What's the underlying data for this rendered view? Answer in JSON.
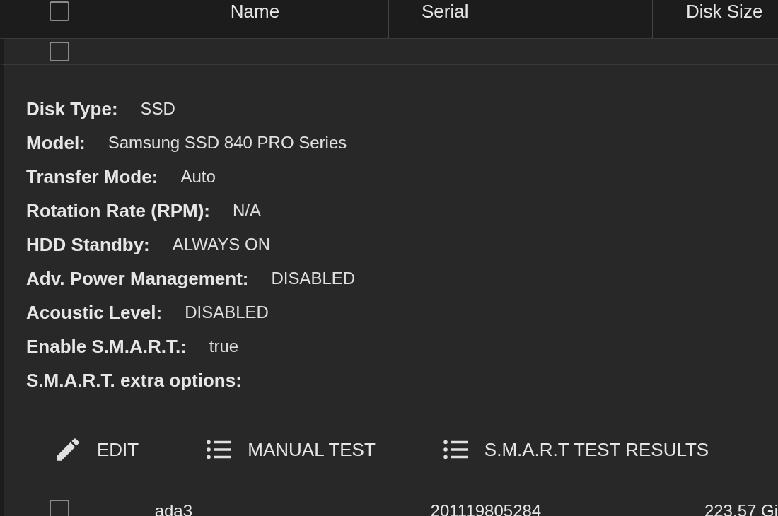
{
  "table": {
    "columns": [
      {
        "label": "Name"
      },
      {
        "label": "Serial"
      },
      {
        "label": "Disk Size"
      }
    ],
    "header_checkbox": {
      "checked": false
    },
    "expanded_row": {
      "checkbox": {
        "checked": false
      },
      "details": [
        {
          "label": "Disk Type:",
          "value": "SSD"
        },
        {
          "label": "Model:",
          "value": "Samsung SSD 840 PRO Series"
        },
        {
          "label": "Transfer Mode:",
          "value": "Auto"
        },
        {
          "label": "Rotation Rate (RPM):",
          "value": "N/A"
        },
        {
          "label": "HDD Standby:",
          "value": "ALWAYS ON"
        },
        {
          "label": "Adv. Power Management:",
          "value": "DISABLED"
        },
        {
          "label": "Acoustic Level:",
          "value": "DISABLED"
        },
        {
          "label": "Enable S.M.A.R.T.:",
          "value": "true"
        },
        {
          "label": "S.M.A.R.T. extra options:"
        }
      ],
      "actions": [
        {
          "kind": "edit",
          "label": "EDIT"
        },
        {
          "kind": "list",
          "label": "MANUAL TEST"
        },
        {
          "kind": "list",
          "label": "S.M.A.R.T TEST RESULTS"
        }
      ]
    },
    "rows": [
      {
        "checked": false,
        "cells": [
          "ada3",
          "201119805284",
          "223.57 Gi"
        ]
      }
    ]
  }
}
